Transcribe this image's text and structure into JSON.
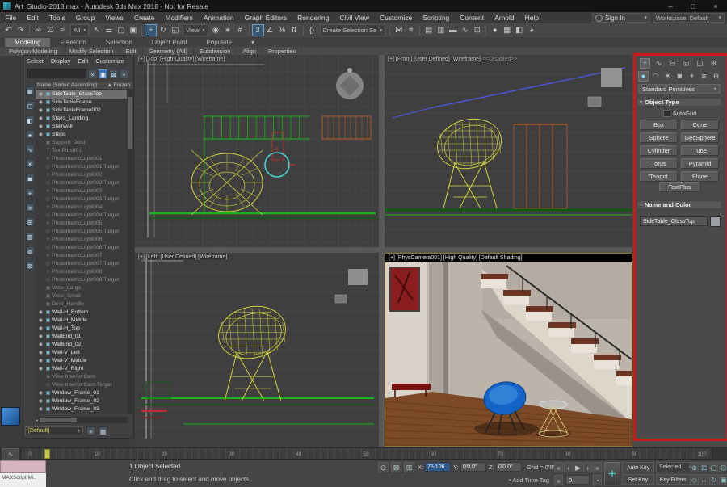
{
  "window": {
    "title": "Art_Studio-2018.max - Autodesk 3ds Max 2018 - Not for Resale",
    "minimize": "–",
    "maximize": "□",
    "close": "×"
  },
  "menubar": {
    "items": [
      "File",
      "Edit",
      "Tools",
      "Group",
      "Views",
      "Create",
      "Modifiers",
      "Animation",
      "Graph Editors",
      "Rendering",
      "Civil View",
      "Customize",
      "Scripting",
      "Content",
      "Arnold",
      "Help"
    ],
    "sign_in": "Sign In",
    "workspace": "Workspace: Default"
  },
  "toolbar": {
    "icons": [
      {
        "name": "undo-icon",
        "glyph": "↶"
      },
      {
        "name": "redo-icon",
        "glyph": "↷"
      },
      {
        "sep": true
      },
      {
        "name": "select-and-link-icon",
        "glyph": "∞"
      },
      {
        "name": "unlink-selection-icon",
        "glyph": "∅"
      },
      {
        "name": "bind-to-space-warp-icon",
        "glyph": "≈"
      },
      {
        "drop": "All",
        "name": "selection-filter-dropdown"
      },
      {
        "name": "select-object-icon",
        "glyph": "↖"
      },
      {
        "name": "select-by-name-icon",
        "glyph": "☰"
      },
      {
        "name": "rectangular-selection-region-icon",
        "glyph": "▢"
      },
      {
        "name": "window-crossing-icon",
        "glyph": "▣"
      },
      {
        "sep": true
      },
      {
        "name": "select-and-move-icon",
        "glyph": "+",
        "active": true
      },
      {
        "name": "select-and-rotate-icon",
        "glyph": "↻"
      },
      {
        "name": "select-and-scale-icon",
        "glyph": "◱"
      },
      {
        "drop": "View",
        "name": "reference-coordinate-dropdown"
      },
      {
        "name": "use-pivot-point-center-icon",
        "glyph": "◉"
      },
      {
        "name": "select-and-manipulate-icon",
        "glyph": "∗"
      },
      {
        "name": "keyboard-shortcut-override-icon",
        "glyph": "#"
      },
      {
        "sep": true
      },
      {
        "name": "snaps-toggle-icon",
        "glyph": "3",
        "active": true
      },
      {
        "name": "angle-snap-icon",
        "glyph": "∠"
      },
      {
        "name": "percent-snap-icon",
        "glyph": "%"
      },
      {
        "name": "spinner-snap-icon",
        "glyph": "⇅"
      },
      {
        "sep": true
      },
      {
        "name": "edit-named-selection-sets-icon",
        "glyph": "{}"
      },
      {
        "drop": "Create Selection Se",
        "name": "named-selection-sets-dropdown"
      },
      {
        "sep": true
      },
      {
        "name": "mirror-icon",
        "glyph": "⋈"
      },
      {
        "name": "align-icon",
        "glyph": "≡"
      },
      {
        "sep": true
      },
      {
        "name": "toggle-scene-explorer-icon",
        "glyph": "▤"
      },
      {
        "name": "toggle-layer-explorer-icon",
        "glyph": "▥"
      },
      {
        "name": "toggle-ribbon-icon",
        "glyph": "▬"
      },
      {
        "name": "curve-editor-icon",
        "glyph": "∿"
      },
      {
        "name": "schematic-view-icon",
        "glyph": "⊡"
      },
      {
        "sep": true
      },
      {
        "name": "material-editor-icon",
        "glyph": "●"
      },
      {
        "name": "render-setup-icon",
        "glyph": "▦"
      },
      {
        "name": "rendered-frame-window-icon",
        "glyph": "◧"
      },
      {
        "name": "render-production-icon",
        "glyph": "◕"
      }
    ]
  },
  "ribbon": {
    "tabs": [
      {
        "label": "Modeling",
        "active": true
      },
      {
        "label": "Freeform",
        "active": false
      },
      {
        "label": "Selection",
        "active": false
      },
      {
        "label": "Object Paint",
        "active": false
      },
      {
        "label": "Populate",
        "active": false
      }
    ],
    "groups": [
      "Polygon Modeling",
      "Modify Selection",
      "Edit",
      "Geometry (All)",
      "Subdivision",
      "Align",
      "Properties"
    ]
  },
  "explorer": {
    "menus": [
      "Select",
      "Display",
      "Edit",
      "Customize"
    ],
    "search_value": "",
    "header_icons": [
      {
        "name": "clear-search-icon",
        "glyph": "×",
        "active": false
      },
      {
        "name": "view-hierarchy-icon",
        "glyph": "▣",
        "active": true
      },
      {
        "name": "lock-explorer-icon",
        "glyph": "⊠",
        "active": false
      },
      {
        "name": "pick-object-icon",
        "glyph": "+",
        "active": false
      }
    ],
    "name_column": "Name (Sorted Ascending)",
    "frozen_column": "▲ Frozen",
    "tool_icons": [
      {
        "name": "display-all-icon",
        "glyph": "▦"
      },
      {
        "name": "display-none-icon",
        "glyph": "▢"
      },
      {
        "name": "display-invert-icon",
        "glyph": "◧"
      },
      {
        "name": "display-geometry-icon",
        "glyph": "●"
      },
      {
        "name": "display-shapes-icon",
        "glyph": "∿"
      },
      {
        "name": "display-lights-icon",
        "glyph": "☀"
      },
      {
        "name": "display-cameras-icon",
        "glyph": "◙"
      },
      {
        "name": "display-helpers-icon",
        "glyph": "⌖"
      },
      {
        "name": "display-spacewarps-icon",
        "glyph": "≋"
      },
      {
        "name": "display-groups-icon",
        "glyph": "⊞"
      },
      {
        "name": "display-xrefs-icon",
        "glyph": "▥"
      },
      {
        "name": "display-materials-icon",
        "glyph": "◍"
      },
      {
        "name": "lock-cell-editing-icon",
        "glyph": "⊠"
      }
    ],
    "items": [
      {
        "label": "SideTable_GlassTop",
        "state": "selected",
        "icon": "geo"
      },
      {
        "label": "SideTableFrame",
        "state": "normal",
        "icon": "geo"
      },
      {
        "label": "SideTableFrame002",
        "state": "normal",
        "icon": "geo"
      },
      {
        "label": "Stairs_Landing",
        "state": "normal",
        "icon": "geo"
      },
      {
        "label": "Stairwall",
        "state": "normal",
        "icon": "geo"
      },
      {
        "label": "Steps",
        "state": "normal",
        "icon": "geo"
      },
      {
        "label": "Support_Joist",
        "state": "hidden",
        "icon": "geo"
      },
      {
        "label": "TextPlus001",
        "state": "hidden",
        "icon": "text"
      },
      {
        "label": "PhotometricLight001",
        "state": "hidden",
        "icon": "light"
      },
      {
        "label": "PhotometricLight001.Target",
        "state": "hidden",
        "icon": "target"
      },
      {
        "label": "PhotometricLight002",
        "state": "hidden",
        "icon": "light"
      },
      {
        "label": "PhotometricLight002.Target",
        "state": "hidden",
        "icon": "target"
      },
      {
        "label": "PhotometricLight003",
        "state": "hidden",
        "icon": "light"
      },
      {
        "label": "PhotometricLight003.Target",
        "state": "hidden",
        "icon": "target"
      },
      {
        "label": "PhotometricLight004",
        "state": "hidden",
        "icon": "light"
      },
      {
        "label": "PhotometricLight004.Target",
        "state": "hidden",
        "icon": "target"
      },
      {
        "label": "PhotometricLight005",
        "state": "hidden",
        "icon": "light"
      },
      {
        "label": "PhotometricLight005.Target",
        "state": "hidden",
        "icon": "target"
      },
      {
        "label": "PhotometricLight006",
        "state": "hidden",
        "icon": "light"
      },
      {
        "label": "PhotometricLight006.Target",
        "state": "hidden",
        "icon": "target"
      },
      {
        "label": "PhotometricLight007",
        "state": "hidden",
        "icon": "light"
      },
      {
        "label": "PhotometricLight007.Target",
        "state": "hidden",
        "icon": "target"
      },
      {
        "label": "PhotometricLight008",
        "state": "hidden",
        "icon": "light"
      },
      {
        "label": "PhotometricLight008.Target",
        "state": "hidden",
        "icon": "target"
      },
      {
        "label": "Vase_Large",
        "state": "hidden",
        "icon": "geo"
      },
      {
        "label": "Vase_Small",
        "state": "hidden",
        "icon": "geo"
      },
      {
        "label": "Door_Handle",
        "state": "hidden",
        "icon": "geo"
      },
      {
        "label": "Wall-H_Bottom",
        "state": "normal",
        "icon": "geo"
      },
      {
        "label": "Wall-H_Middle",
        "state": "normal",
        "icon": "geo"
      },
      {
        "label": "Wall-H_Top",
        "state": "normal",
        "icon": "geo"
      },
      {
        "label": "WallEnd_01",
        "state": "normal",
        "icon": "geo"
      },
      {
        "label": "WallEnd_02",
        "state": "normal",
        "icon": "geo"
      },
      {
        "label": "Wall-V_Left",
        "state": "normal",
        "icon": "geo"
      },
      {
        "label": "Wall-V_Middle",
        "state": "normal",
        "icon": "geo"
      },
      {
        "label": "Wall-V_Right",
        "state": "normal",
        "icon": "geo"
      },
      {
        "label": "View Interior Cam",
        "state": "hidden",
        "icon": "camera"
      },
      {
        "label": "View Interior Cam.Target",
        "state": "hidden",
        "icon": "target"
      },
      {
        "label": "Window_Frame_01",
        "state": "normal",
        "icon": "geo"
      },
      {
        "label": "Window_Frame_02",
        "state": "normal",
        "icon": "geo"
      },
      {
        "label": "Window_Frame_03",
        "state": "normal",
        "icon": "geo"
      }
    ],
    "footer": {
      "selection_set": "[Default]"
    }
  },
  "viewports": {
    "top_label": "[+] [Top] [High Quality] [Wireframe]",
    "front_label": "[+] [Front] [User Defined] [Wireframe]",
    "front_suffix": "<<Disabled>>",
    "left_label": "[+] [Left] [User Defined] [Wireframe]",
    "camera_label": "[+] [PhysCamera001] [High Quality] [Default Shading]"
  },
  "panel": {
    "tabs": [
      {
        "name": "create-tab-icon",
        "glyph": "+",
        "active": true
      },
      {
        "name": "modify-tab-icon",
        "glyph": "∿",
        "active": false
      },
      {
        "name": "hierarchy-tab-icon",
        "glyph": "⊟",
        "active": false
      },
      {
        "name": "motion-tab-icon",
        "glyph": "◎",
        "active": false
      },
      {
        "name": "display-tab-icon",
        "glyph": "▢",
        "active": false
      },
      {
        "name": "utilities-tab-icon",
        "glyph": "⊛",
        "active": false
      }
    ],
    "categories": [
      {
        "name": "geometry-category-icon",
        "glyph": "●",
        "active": true
      },
      {
        "name": "shapes-category-icon",
        "glyph": "◠",
        "active": false
      },
      {
        "name": "lights-category-icon",
        "glyph": "☀",
        "active": false
      },
      {
        "name": "cameras-category-icon",
        "glyph": "◙",
        "active": false
      },
      {
        "name": "helpers-category-icon",
        "glyph": "⌖",
        "active": false
      },
      {
        "name": "spacewarps-category-icon",
        "glyph": "≋",
        "active": false
      },
      {
        "name": "systems-category-icon",
        "glyph": "⊕",
        "active": false
      }
    ],
    "dropdown": "Standard Primitives",
    "object_type": {
      "title": "Object Type",
      "autogrid": "AutoGrid",
      "buttons": [
        "Box",
        "Cone",
        "Sphere",
        "GeoSphere",
        "Cylinder",
        "Tube",
        "Torus",
        "Pyramid",
        "Teapot",
        "Plane",
        "TextPlus"
      ]
    },
    "name_color": {
      "title": "Name and Color",
      "value": "SideTable_GlassTop"
    }
  },
  "timeline": {
    "ticks": [
      "0",
      "10",
      "20",
      "30",
      "40",
      "50",
      "60",
      "70",
      "80",
      "90",
      "100"
    ],
    "current": "0"
  },
  "status": {
    "listener": "MAXScript Mi..",
    "selection": "1 Object Selected",
    "prompt": "Click and drag to select and move objects",
    "x_label": "X:",
    "x_value": "75.106",
    "y_label": "Y:",
    "y_value": "0'0.0\"",
    "z_label": "Z:",
    "z_value": "0'0.0\"",
    "grid": "Grid = 0'8\"",
    "time_tag": "Add Time Tag",
    "frame": "0",
    "auto_key": "Auto Key",
    "set_key": "Set Key",
    "selected_set": "Selected",
    "key_filters": "Key Filters...",
    "playback": [
      {
        "name": "go-to-start-icon",
        "glyph": "«"
      },
      {
        "name": "previous-frame-icon",
        "glyph": "‹"
      },
      {
        "name": "play-icon",
        "glyph": "▶"
      },
      {
        "name": "next-frame-icon",
        "glyph": "›"
      },
      {
        "name": "go-to-end-icon",
        "glyph": "»"
      }
    ],
    "nav": [
      {
        "name": "zoom-icon",
        "glyph": "⊕"
      },
      {
        "name": "zoom-all-icon",
        "glyph": "⊞"
      },
      {
        "name": "zoom-extents-icon",
        "glyph": "▢"
      },
      {
        "name": "zoom-extents-all-icon",
        "glyph": "⊡"
      },
      {
        "name": "field-of-view-icon",
        "glyph": "◇"
      },
      {
        "name": "pan-icon",
        "glyph": "↔"
      },
      {
        "name": "orbit-icon",
        "glyph": "↻"
      },
      {
        "name": "maximize-viewport-icon",
        "glyph": "▣"
      }
    ]
  },
  "colors": {
    "wire": "#d2d23c",
    "green": "#19b619",
    "green_dark": "#0b5c0b",
    "cyan": "#46d8d0",
    "orange": "#b05a28",
    "red": "#c03030",
    "blue": "#4a5ae8",
    "grid": "#474747",
    "arch": "#a8a8a8",
    "panel_red": "#cc1a1a",
    "camera": {
      "wall": "#bcb4aa",
      "wall_left": "#d8d2c8",
      "pillar": "#aca49a",
      "pillar_shade": "#8a8278",
      "floor": "#7c4a26",
      "floor_line": "#5f3619",
      "tread": "#6b3422",
      "riser": "#e8e2d8",
      "stringer": "#ddd6ca",
      "under": "#9a9288",
      "chair": "#1565c8",
      "chair_hi": "#2f82d6",
      "art": "#8a1d1d",
      "bench": "#7a1212",
      "wire_table": "#d8c878",
      "rail": "#2a2a2a"
    }
  }
}
